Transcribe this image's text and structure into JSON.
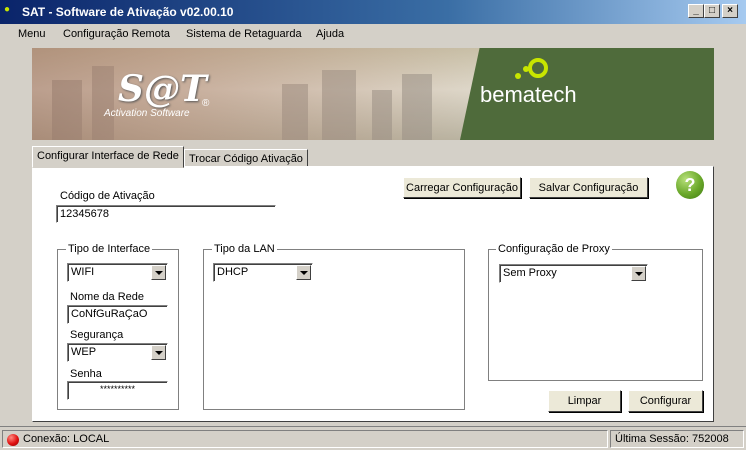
{
  "window": {
    "title": "SAT - Software de Ativação v02.00.10",
    "controls": {
      "minimize": "_",
      "maximize": "□",
      "close": "×"
    }
  },
  "menu": [
    "Menu",
    "Configuração Remota",
    "Sistema de Retaguarda",
    "Ajuda"
  ],
  "banner": {
    "logo_text": "S@T",
    "logo_mark": "®",
    "logo_subtitle": "Activation Software",
    "brand": "bematech"
  },
  "tabs": [
    {
      "label": "Configurar Interface de Rede",
      "active": true
    },
    {
      "label": "Trocar Código Ativação",
      "active": false
    }
  ],
  "form": {
    "activation_code_label": "Código de Ativação",
    "activation_code_value": "12345678",
    "load_config_button": "Carregar Configuração",
    "save_config_button": "Salvar Configuração",
    "help_button": "?",
    "interface_group": {
      "title": "Tipo de Interface",
      "interface_value": "WIFI",
      "network_name_label": "Nome da Rede",
      "network_name_value": "CoNfGuRaÇaO",
      "security_label": "Segurança",
      "security_value": "WEP",
      "password_label": "Senha",
      "password_value": "**********"
    },
    "lan_group": {
      "title": "Tipo da LAN",
      "lan_value": "DHCP"
    },
    "proxy_group": {
      "title": "Configuração de Proxy",
      "proxy_value": "Sem Proxy"
    },
    "clear_button": "Limpar",
    "configure_button": "Configurar"
  },
  "status": {
    "connection": "Conexão: LOCAL",
    "last_session": "Última Sessão: 752008"
  },
  "colors": {
    "title_bar": "#0a246a",
    "window_bg": "#d4d0c8",
    "banner_green": "#4f6b3b",
    "accent_green": "#6aa82a",
    "status_red": "#e01010"
  }
}
